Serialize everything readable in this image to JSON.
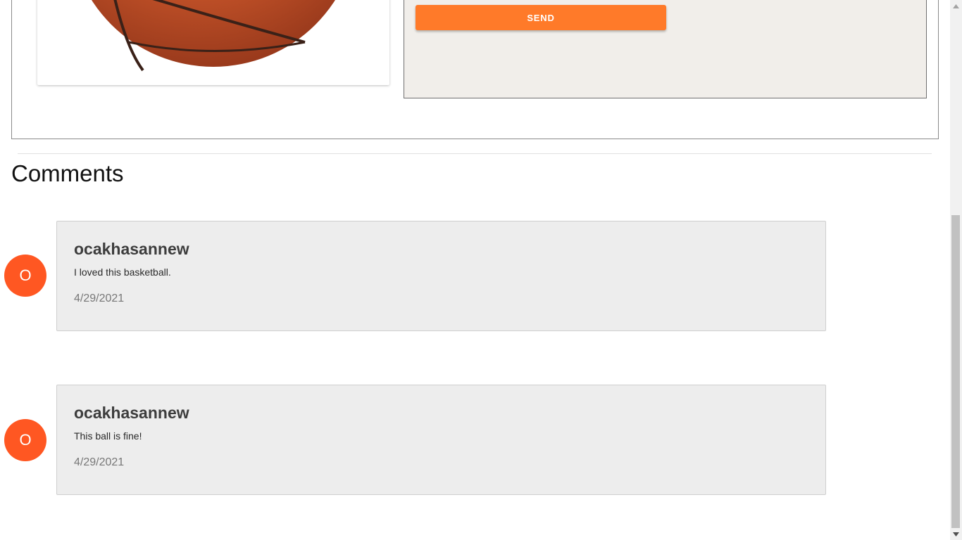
{
  "product": {
    "image_alt": "basketball"
  },
  "form": {
    "send_label": "SEND"
  },
  "comments": {
    "title": "Comments",
    "items": [
      {
        "avatar_letter": "O",
        "username": "ocakhasannew",
        "text": "I loved this basketball.",
        "date": "4/29/2021"
      },
      {
        "avatar_letter": "O",
        "username": "ocakhasannew",
        "text": "This ball is fine!",
        "date": "4/29/2021"
      }
    ]
  },
  "colors": {
    "accent": "#ff7a29",
    "avatar": "#ff5722",
    "comment_bg": "#ededed",
    "form_bg": "#f1eeea"
  },
  "icons": {
    "scroll_up": "triangle-up-icon",
    "scroll_down": "triangle-down-icon"
  }
}
